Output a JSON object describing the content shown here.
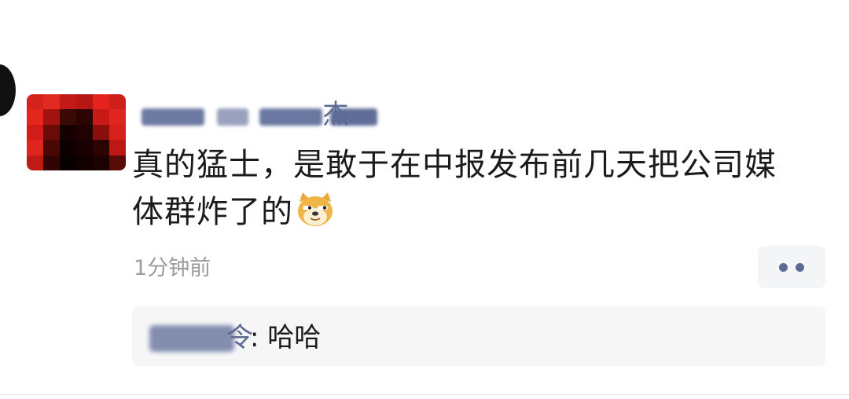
{
  "comment": {
    "author_visible_fragment": "杰",
    "text": "真的猛士，是敢于在中报发布前几天把公司媒体群炸了的",
    "emoji_icon": "doge-emoji",
    "time": "1分钟前",
    "more_icon": "more-dots-icon"
  },
  "reply": {
    "author_visible_fragment": "令",
    "text": ": 哈哈"
  },
  "colors": {
    "name_link": "#5b6a92",
    "body_text": "#1b1b1b",
    "meta_text": "#9b9b9b",
    "reply_bg": "#f6f6f7",
    "avatar_red": "#d11a1a"
  }
}
